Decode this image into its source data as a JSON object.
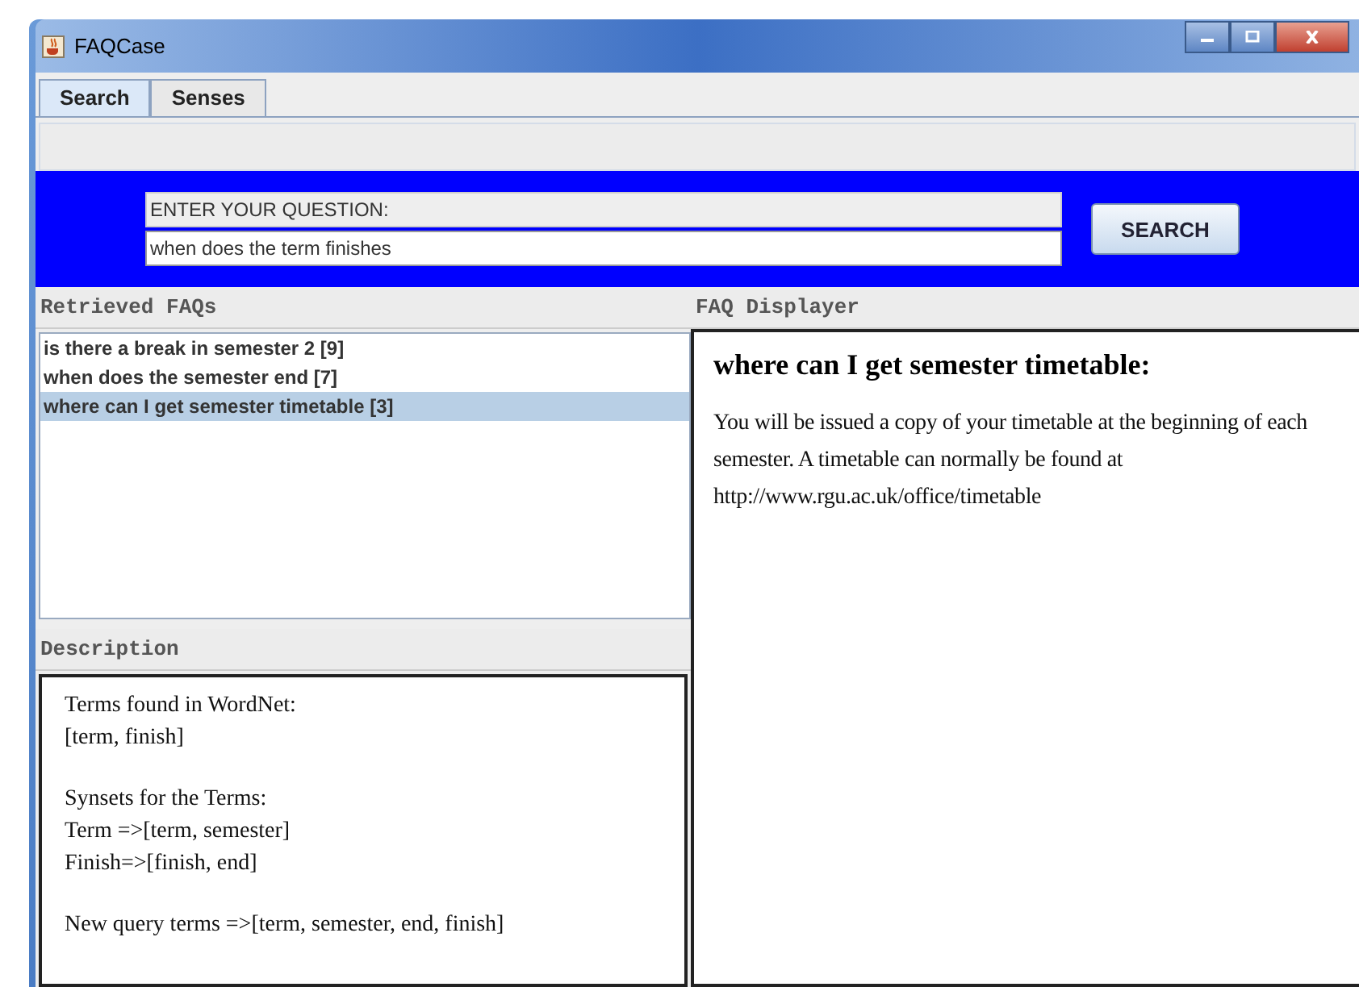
{
  "window": {
    "title": "FAQCase"
  },
  "tabs": [
    {
      "label": "Search",
      "selected": true
    },
    {
      "label": "Senses",
      "selected": false
    }
  ],
  "search": {
    "label": "ENTER YOUR QUESTION:",
    "value": "when does the term finishes",
    "button": "SEARCH"
  },
  "retrieved": {
    "title": "Retrieved FAQs",
    "items": [
      {
        "label": "is there a break in semester 2 [9]",
        "selected": false
      },
      {
        "label": "when does the semester end [7]",
        "selected": false
      },
      {
        "label": "where can I get semester timetable [3]",
        "selected": true
      }
    ]
  },
  "description": {
    "title": "Description",
    "paragraphs": [
      [
        "Terms found in WordNet:",
        "[term, finish]"
      ],
      [
        "Synsets for the Terms:",
        "Term =>[term, semester]",
        "Finish=>[finish, end]"
      ],
      [
        "New query terms =>[term, semester, end, finish]"
      ]
    ]
  },
  "displayer": {
    "title": "FAQ Displayer",
    "question": "where can I get semester timetable:",
    "answer": "You will be issued a copy of your timetable at the beginning of each semester. A timetable can normally be found at http://www.rgu.ac.uk/office/timetable"
  }
}
